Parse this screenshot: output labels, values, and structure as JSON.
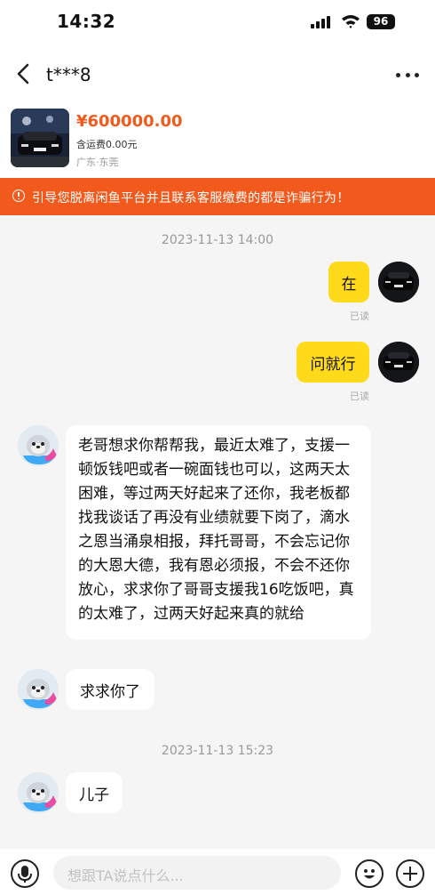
{
  "status_bar": {
    "time": "14:32",
    "battery": "96"
  },
  "nav": {
    "title": "t***8"
  },
  "product": {
    "price": "¥600000.00",
    "shipping": "含运费0.00元",
    "location": "广东·东莞"
  },
  "warning": {
    "text": "引导您脱离闲鱼平台并且联系客服缴费的都是诈骗行为！"
  },
  "chat": {
    "timestamp_1": "2023-11-13 14:00",
    "timestamp_2": "2023-11-13 15:23",
    "messages": [
      {
        "from": "me",
        "text": "在",
        "status": "已读"
      },
      {
        "from": "me",
        "text": "问就行",
        "status": "已读"
      },
      {
        "from": "other",
        "text": "老哥想求你帮帮我，最近太难了，支援一顿饭钱吧或者一碗面钱也可以，这两天太困难，等过两天好起来了还你，我老板都找我谈话了再没有业绩就要下岗了，滴水之恩当涌泉相报，拜托哥哥，不会忘记你的大恩大德，我有恩必须报，不会不还你放心，求求你了哥哥支援我16吃饭吧，真的太难了，过两天好起来真的就给"
      },
      {
        "from": "other",
        "text": "求求你了"
      },
      {
        "from": "other",
        "text": "儿子"
      }
    ]
  },
  "input": {
    "placeholder": "想跟TA说点什么..."
  },
  "colors": {
    "accent": "#f25a1d",
    "my_bubble": "#ffda1a",
    "background": "#f5f5f5"
  }
}
